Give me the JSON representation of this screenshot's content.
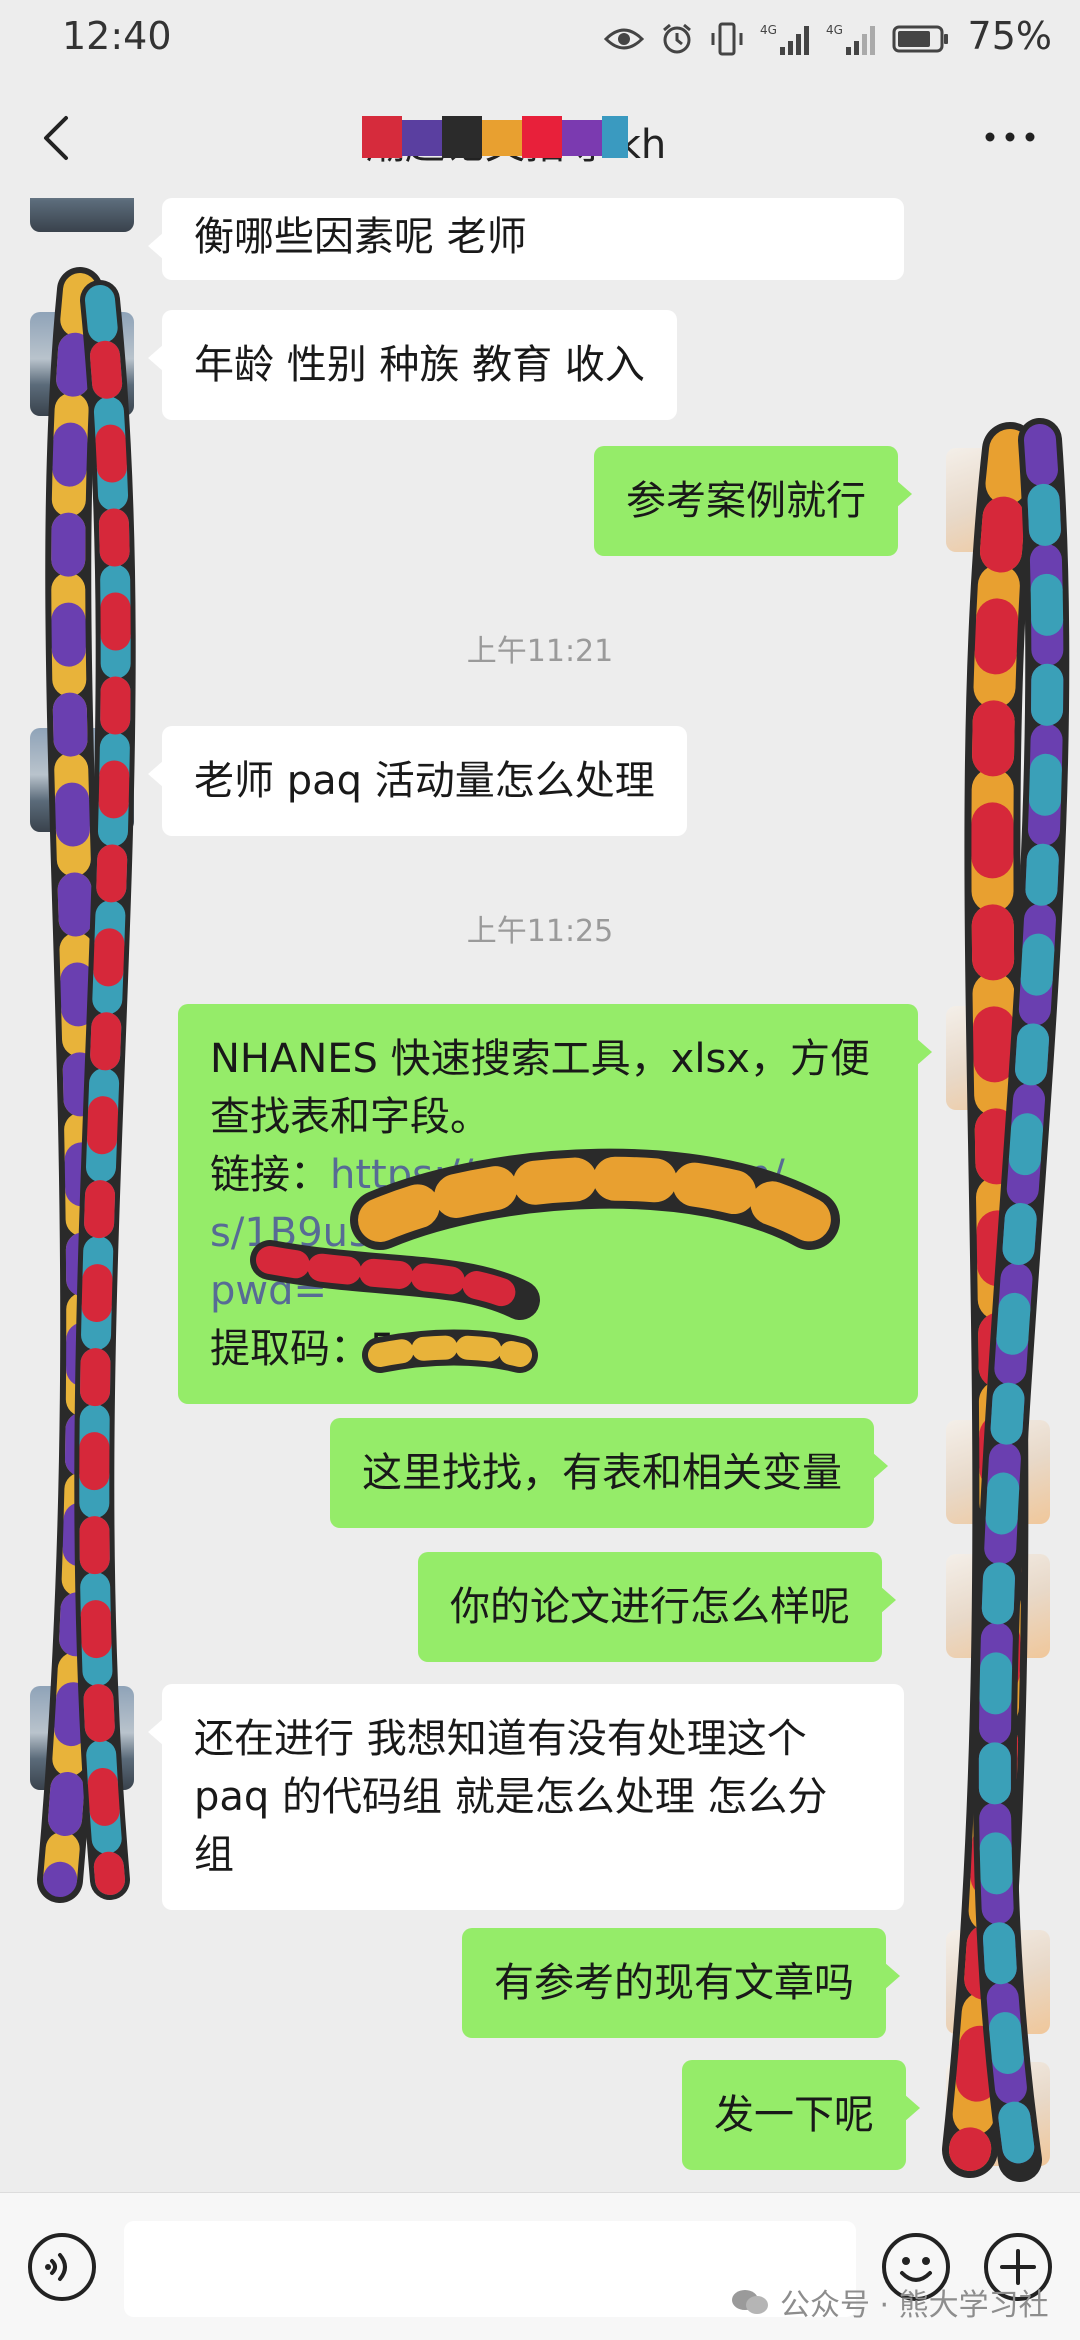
{
  "status_bar": {
    "time": "12:40",
    "battery": "75%",
    "icons": [
      "eye-icon",
      "alarm-icon",
      "vibrate-icon",
      "signal-4g-icon",
      "signal-4g-icon",
      "battery-icon"
    ]
  },
  "nav": {
    "title": "潮起论文指导.kh",
    "more_icon": "more-icon",
    "back_icon": "back-icon"
  },
  "messages": [
    {
      "side": "in",
      "lines": [
        "衡哪些因素呢 老师"
      ]
    },
    {
      "side": "in",
      "lines": [
        "年龄 性别 种族 教育 收入"
      ]
    },
    {
      "side": "out",
      "lines": [
        "参考案例就行"
      ]
    },
    {
      "type": "time",
      "text": "上午11:21"
    },
    {
      "side": "in",
      "lines": [
        "老师 paq 活动量怎么处理"
      ]
    },
    {
      "type": "time",
      "text": "上午11:25"
    },
    {
      "side": "out",
      "lines": [
        "NHANES 快速搜索工具，xlsx，方便",
        "查找表和字段。"
      ],
      "link_label": "链接：",
      "link_lines": [
        "https://pan.baidu.com/",
        "s/1B9u5",
        "pwd="
      ],
      "code_label": "提取码：",
      "code_value": "5c3d"
    },
    {
      "side": "out",
      "lines": [
        "这里找找，有表和相关变量"
      ]
    },
    {
      "side": "out",
      "lines": [
        "你的论文进行怎么样呢"
      ]
    },
    {
      "side": "in",
      "lines": [
        "还在进行 我想知道有没有处理这个",
        "paq 的代码组 就是怎么处理 怎么分",
        "组"
      ]
    },
    {
      "side": "out",
      "lines": [
        "有参考的现有文章吗"
      ]
    },
    {
      "side": "out",
      "lines": [
        "发一下呢"
      ]
    }
  ],
  "input_bar": {
    "voice_icon": "voice-icon",
    "emoji_icon": "emoji-icon",
    "plus_icon": "plus-icon"
  },
  "watermark": "公众号 · 熊大学习社",
  "colors": {
    "background": "#ededed",
    "incoming_bubble": "#ffffff",
    "outgoing_bubble": "#95ec69",
    "link": "#576b95",
    "timestamp": "#9a9a9a"
  }
}
